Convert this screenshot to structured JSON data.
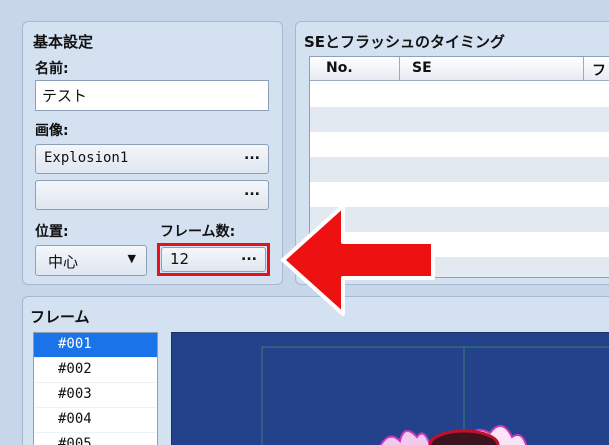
{
  "basic": {
    "title": "基本設定",
    "name_label": "名前:",
    "name_value": "テスト",
    "image_label": "画像:",
    "image1_value": "Explosion1",
    "image2_value": "",
    "ellipsis": "...",
    "position_label": "位置:",
    "position_value": "中心",
    "frame_count_label": "フレーム数:",
    "frame_count_value": "12"
  },
  "timing": {
    "title": "SEとフラッシュのタイミング",
    "columns": [
      "No.",
      "SE",
      "フ"
    ]
  },
  "frames": {
    "title": "フレーム",
    "items": [
      "#001",
      "#002",
      "#003",
      "#004",
      "#005"
    ],
    "selected": "#001"
  },
  "colors": {
    "highlight_box": "#e0141a",
    "arrow": "#ee1111",
    "selection": "#1a73e8",
    "preview_bg": "#24418c"
  }
}
